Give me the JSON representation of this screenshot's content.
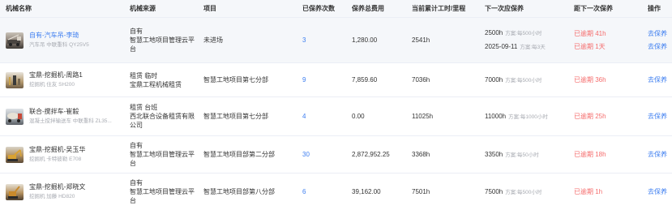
{
  "columns": {
    "name": "机械名称",
    "source": "机械来源",
    "project": "项目",
    "count": "已保养次数",
    "cost": "保养总费用",
    "hours": "当前累计工时/里程",
    "next": "下一次应保养",
    "distance": "距下一次保养",
    "ops": "操作"
  },
  "rows": [
    {
      "name": "自有-汽车吊-李琦",
      "sub": "汽车吊 中联重科 QY25V5",
      "source": [
        "自有",
        "智慧工地项目管理云平",
        "台"
      ],
      "project": "未进场",
      "count": "3",
      "cost": "1,280.00",
      "hours": "2541h",
      "next": [
        {
          "value": "2500h",
          "plan": "方案:每500小时"
        },
        {
          "value": "2025-09-11",
          "plan": "方案:每3天"
        }
      ],
      "distance": [
        "已逾期 41h",
        "已逾期 1天"
      ],
      "ops": [
        "去保养",
        "去保养"
      ]
    },
    {
      "name": "宝鼎-挖掘机-周路1",
      "sub": "挖掘机 住友 SH200",
      "source": [
        "租赁  临时",
        "宝鼎工程机械租赁"
      ],
      "project": "智慧工地项目第七分部",
      "count": "9",
      "cost": "7,859.60",
      "hours": "7036h",
      "next": [
        {
          "value": "7000h",
          "plan": "方案:每500小时"
        }
      ],
      "distance": [
        "已逾期 36h"
      ],
      "ops": [
        "去保养"
      ]
    },
    {
      "name": "联合-搅拌车-崔毅",
      "sub": "混凝土搅拌输送车 中联重科 ZL35...",
      "source": [
        "租赁  台班",
        "西北联合设备租赁有限",
        "公司"
      ],
      "project": "智慧工地项目第七分部",
      "count": "4",
      "cost": "0.00",
      "hours": "11025h",
      "next": [
        {
          "value": "11000h",
          "plan": "方案:每1000小时"
        }
      ],
      "distance": [
        "已逾期 25h"
      ],
      "ops": [
        "去保养"
      ]
    },
    {
      "name": "宝鼎-挖掘机-吴玉华",
      "sub": "挖掘机 卡特彼勒 E708",
      "source": [
        "自有",
        "智慧工地项目管理云平",
        "台"
      ],
      "project": "智慧工地项目部第二分部",
      "count": "30",
      "cost": "2,872,952.25",
      "hours": "3368h",
      "next": [
        {
          "value": "3350h",
          "plan": "方案:每50小时"
        }
      ],
      "distance": [
        "已逾期 18h"
      ],
      "ops": [
        "去保养"
      ]
    },
    {
      "name": "宝鼎-挖掘机-郑晓文",
      "sub": "挖掘机 加藤 HD820",
      "source": [
        "自有",
        "智慧工地项目管理云平",
        "台"
      ],
      "project": "智慧工地项目部第八分部",
      "count": "6",
      "cost": "39,162.00",
      "hours": "7501h",
      "next": [
        {
          "value": "7500h",
          "plan": "方案:每500小时"
        }
      ],
      "distance": [
        "已逾期 1h"
      ],
      "ops": [
        "去保养"
      ]
    }
  ],
  "colors": {
    "link": "#3d7ef0",
    "overdue": "#f56c6c",
    "muted": "#a8abb2",
    "header_bg": "#f5f7fa"
  }
}
